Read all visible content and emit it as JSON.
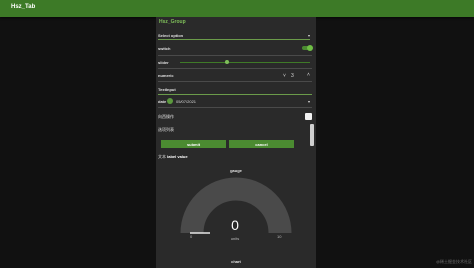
{
  "header": {
    "title": "Hsz_Tab"
  },
  "group": {
    "title": "Hsz_Group",
    "select_label": "Select option",
    "switch_label": "switch",
    "switch_on": true,
    "slider_label": "slider",
    "slider_value_fraction": 0.36,
    "numeric_label": "numeric",
    "numeric_value": "3",
    "textbox_label": "TextInput",
    "date_label": "date",
    "date_value": "05/07/2021",
    "checkbox_label": "向西操作",
    "checkbox_checked": false,
    "list_label": "选项列表",
    "submit_label": "submit",
    "cancel_label": "cancel",
    "text_label": "文本",
    "text_value": "label value",
    "gauge": {
      "title": "gauge",
      "value": "0",
      "units": "units",
      "min": "0",
      "max": "10",
      "fraction": 0.0
    },
    "chart_title": "chart"
  },
  "watermark": "@稀土掘金技术社区",
  "colors": {
    "accent": "#3d7a27",
    "gauge_track": "#4a4a4a",
    "card": "#2a2a2a"
  }
}
